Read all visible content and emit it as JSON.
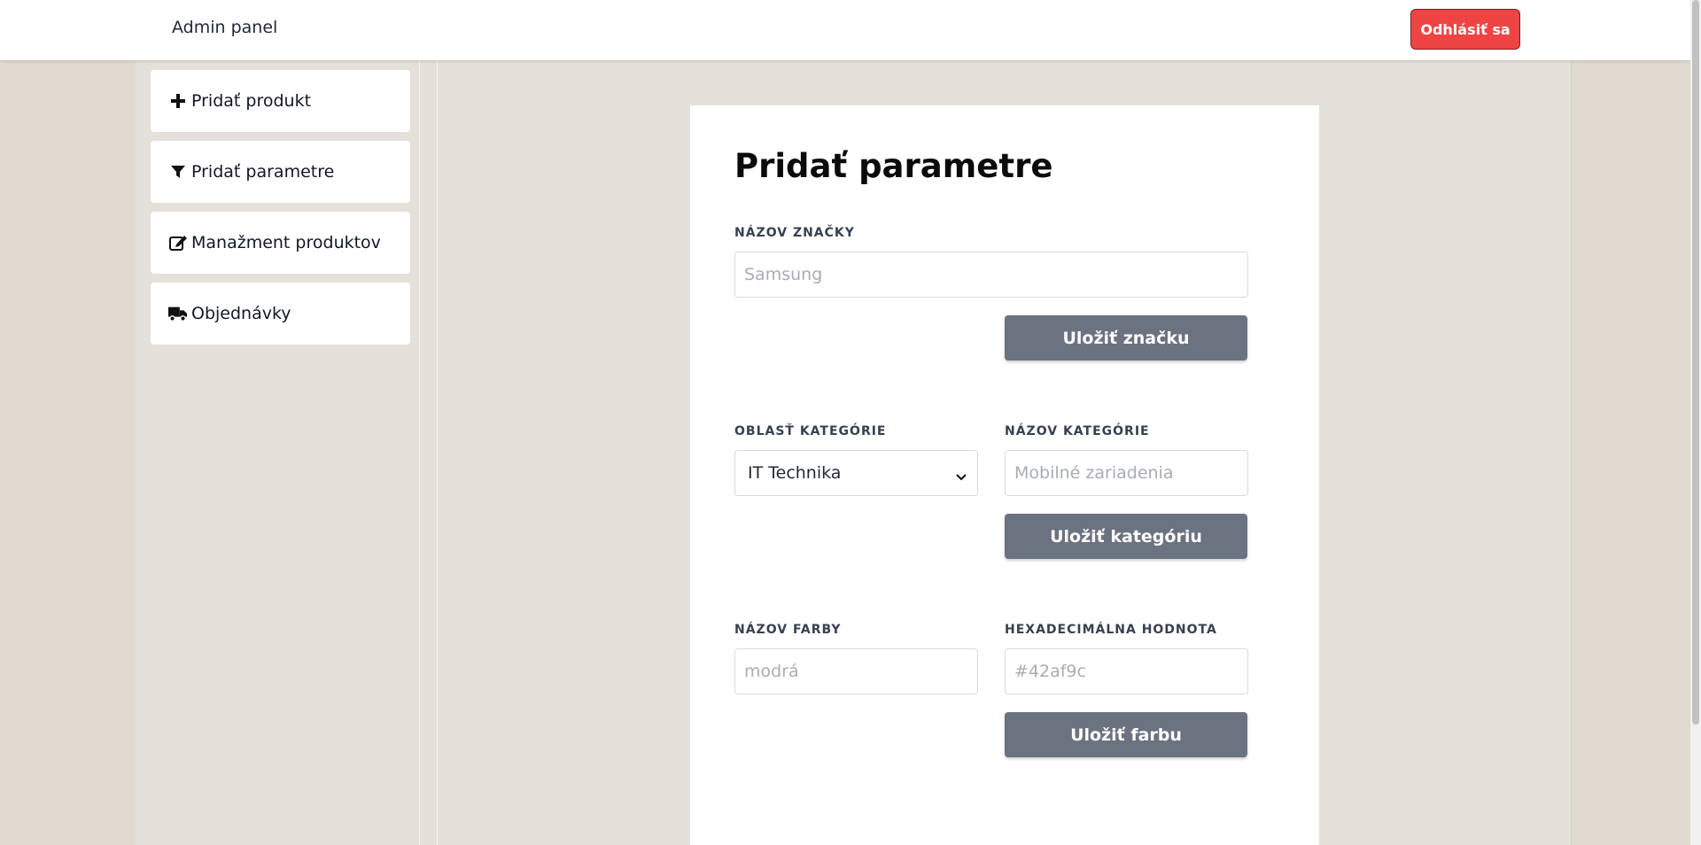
{
  "header": {
    "title": "Admin panel",
    "logout_label": "Odhlásiť sa"
  },
  "sidebar": {
    "items": [
      {
        "label": "Pridať produkt",
        "icon": "plus-icon"
      },
      {
        "label": "Pridať parametre",
        "icon": "filter-icon"
      },
      {
        "label": "Manažment produktov",
        "icon": "edit-icon"
      },
      {
        "label": "Objednávky",
        "icon": "truck-icon"
      }
    ]
  },
  "form": {
    "title": "Pridať parametre",
    "brand": {
      "label": "NÁZOV ZNAČKY",
      "placeholder": "Samsung",
      "value": "",
      "button": "Uložiť značku"
    },
    "category": {
      "area_label": "OBLASŤ KATEGÓRIE",
      "area_selected": "IT Technika",
      "name_label": "NÁZOV KATEGÓRIE",
      "name_placeholder": "Mobilné zariadenia",
      "name_value": "",
      "button": "Uložiť kategóriu"
    },
    "color": {
      "name_label": "NÁZOV FARBY",
      "name_placeholder": "modrá",
      "hex_label": "HEXADECIMÁLNA HODNOTA",
      "hex_placeholder": "#42af9c",
      "button": "Uložiť farbu"
    }
  },
  "colors": {
    "logout": "#ef4444",
    "button": "#6b7280",
    "background": "#e4e1da"
  }
}
